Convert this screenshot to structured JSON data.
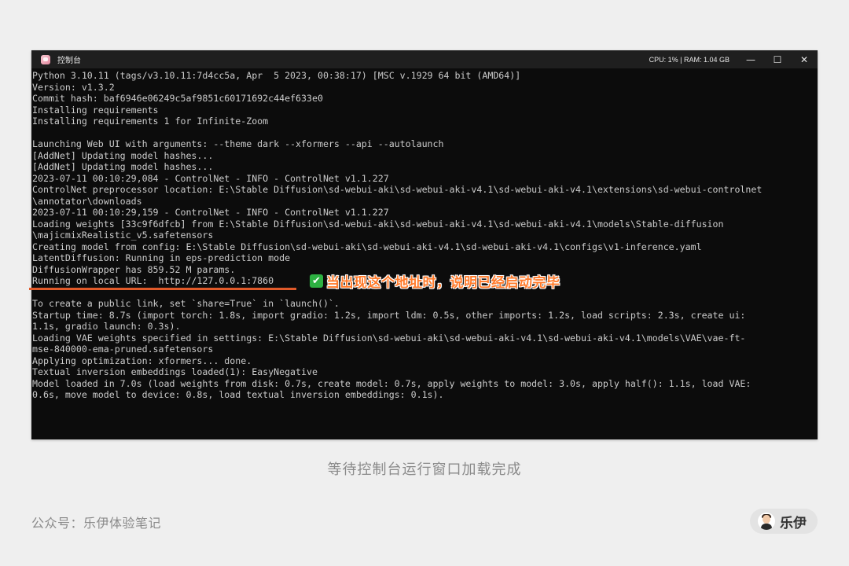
{
  "window": {
    "title": "控制台",
    "status": "CPU: 1% | RAM: 1.04 GB",
    "minimize_glyph": "—",
    "maximize_glyph": "☐",
    "close_glyph": "✕"
  },
  "terminal": {
    "lines": [
      "Python 3.10.11 (tags/v3.10.11:7d4cc5a, Apr  5 2023, 00:38:17) [MSC v.1929 64 bit (AMD64)]",
      "Version: v1.3.2",
      "Commit hash: baf6946e06249c5af9851c60171692c44ef633e0",
      "Installing requirements",
      "Installing requirements 1 for Infinite-Zoom",
      "",
      "Launching Web UI with arguments: --theme dark --xformers --api --autolaunch",
      "[AddNet] Updating model hashes...",
      "[AddNet] Updating model hashes...",
      "2023-07-11 00:10:29,084 - ControlNet - INFO - ControlNet v1.1.227",
      "ControlNet preprocessor location: E:\\Stable Diffusion\\sd-webui-aki\\sd-webui-aki-v4.1\\sd-webui-aki-v4.1\\extensions\\sd-webui-controlnet",
      "\\annotator\\downloads",
      "2023-07-11 00:10:29,159 - ControlNet - INFO - ControlNet v1.1.227",
      "Loading weights [33c9f6dfcb] from E:\\Stable Diffusion\\sd-webui-aki\\sd-webui-aki-v4.1\\sd-webui-aki-v4.1\\models\\Stable-diffusion",
      "\\majicmixRealistic_v5.safetensors",
      "Creating model from config: E:\\Stable Diffusion\\sd-webui-aki\\sd-webui-aki-v4.1\\sd-webui-aki-v4.1\\configs\\v1-inference.yaml",
      "LatentDiffusion: Running in eps-prediction mode",
      "DiffusionWrapper has 859.52 M params.",
      "Running on local URL:  http://127.0.0.1:7860",
      "",
      "To create a public link, set `share=True` in `launch()`.",
      "Startup time: 8.7s (import torch: 1.8s, import gradio: 1.2s, import ldm: 0.5s, other imports: 1.2s, load scripts: 2.3s, create ui:",
      "1.1s, gradio launch: 0.3s).",
      "Loading VAE weights specified in settings: E:\\Stable Diffusion\\sd-webui-aki\\sd-webui-aki-v4.1\\sd-webui-aki-v4.1\\models\\VAE\\vae-ft-",
      "mse-840000-ema-pruned.safetensors",
      "Applying optimization: xformers... done.",
      "Textual inversion embeddings loaded(1): EasyNegative",
      "Model loaded in 7.0s (load weights from disk: 0.7s, create model: 0.7s, apply weights to model: 3.0s, apply half(): 1.1s, load VAE:",
      "0.6s, move model to device: 0.8s, load textual inversion embeddings: 0.1s)."
    ]
  },
  "annotation": {
    "check_glyph": "✔",
    "text": "当出现这个地址时，说明已经启动完毕"
  },
  "caption": "等待控制台运行窗口加载完成",
  "footer": {
    "account": "公众号：乐伊体验笔记",
    "author": "乐伊"
  },
  "colors": {
    "terminal_bg": "#0c0c0c",
    "terminal_text": "#cccccc",
    "highlight": "#e05a2a",
    "annotation_text": "#ff7a2a",
    "check": "#2db142"
  }
}
